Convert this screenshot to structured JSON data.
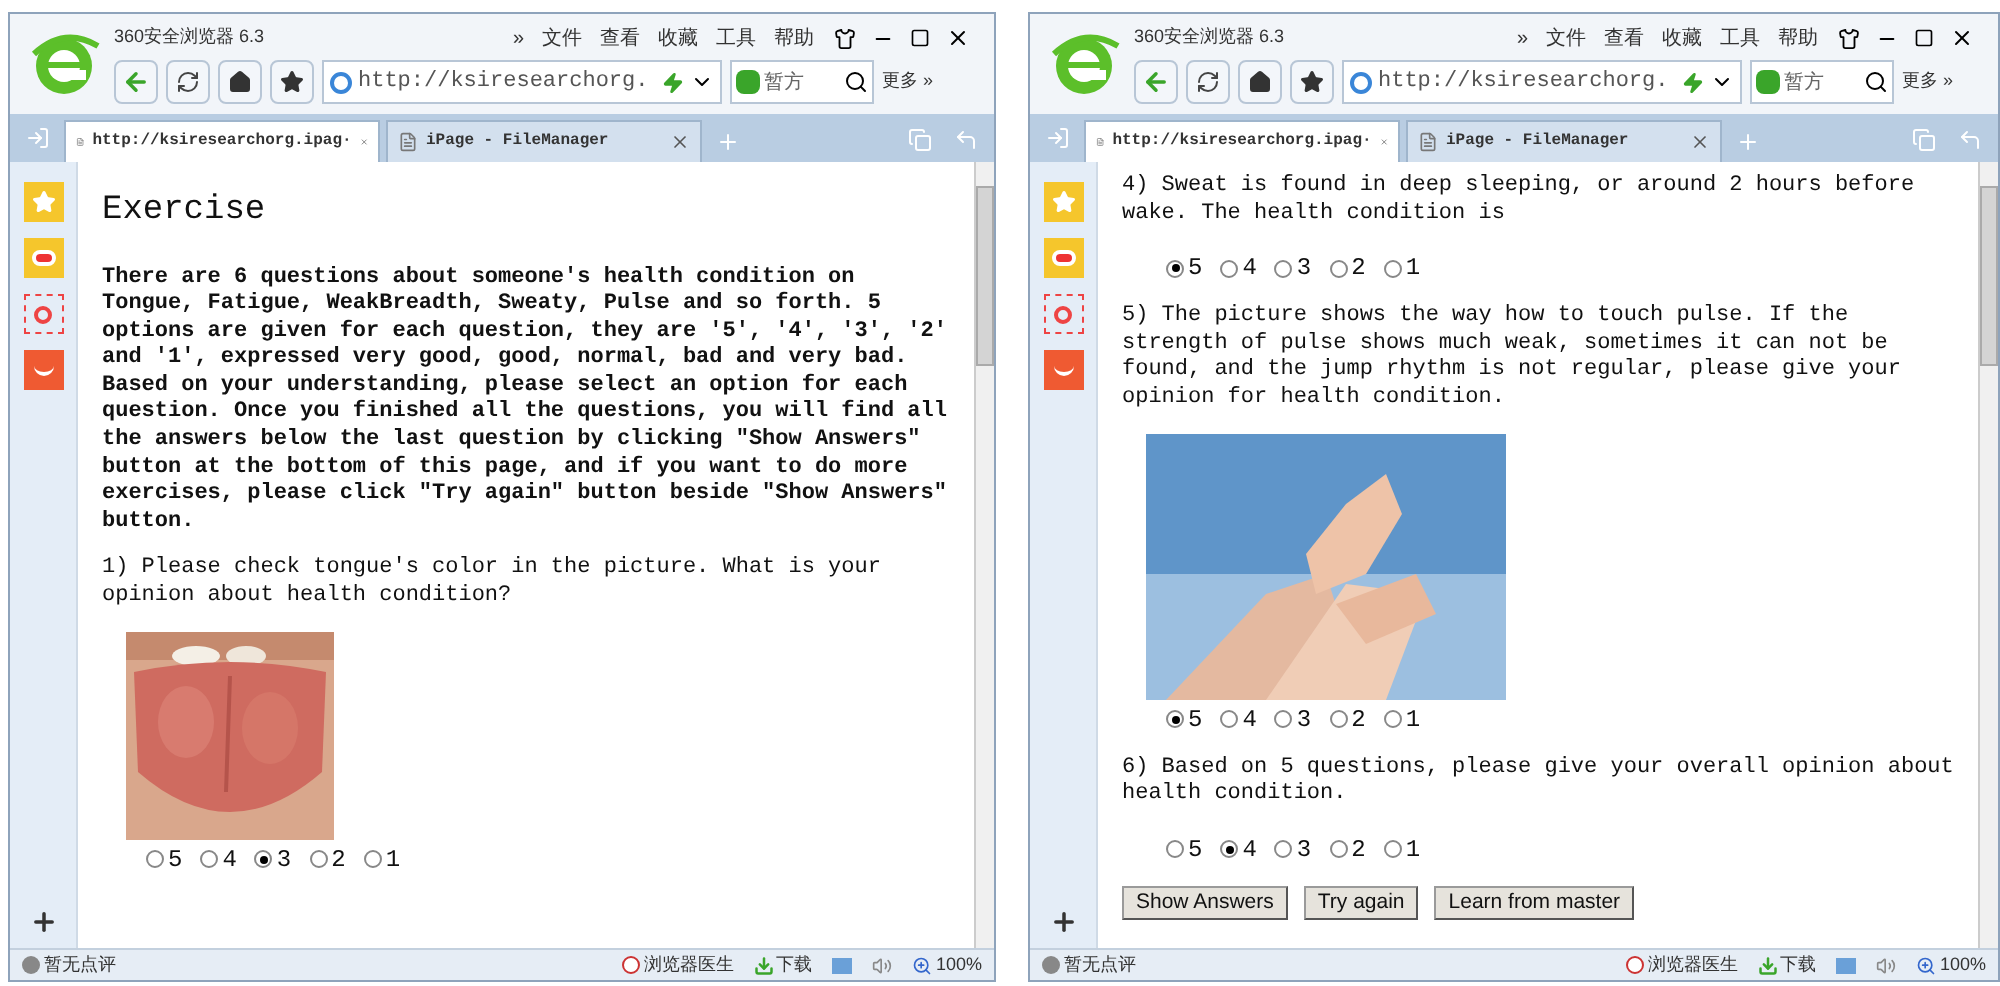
{
  "windows": [
    {
      "title": "360安全浏览器 6.3",
      "menu": [
        "»",
        "文件",
        "查看",
        "收藏",
        "工具",
        "帮助"
      ],
      "url": "http://ksiresearchorg.",
      "search_text": "暂方",
      "more": "更多 »",
      "tabs": [
        {
          "label": "http://ksiresearchorg.ipag·",
          "selected": true
        },
        {
          "label": "iPage - FileManager",
          "selected": false
        }
      ],
      "blocks": [
        {
          "kind": "heading",
          "text": "Exercise"
        },
        {
          "kind": "paragraph",
          "bold": true,
          "text": "There are 6 questions about someone's health condition on Tongue, Fatigue, WeakBreadth, Sweaty, Pulse and so forth. 5 options are given for each question, they are '5', '4', '3', '2' and '1', expressed very good, good, normal, bad and very bad. Based on your understanding, please select an option for each question. Once you finished all the questions, you will find all the answers below the last question by clicking \"Show Answers\" button at the bottom of this page, and if you want to do more exercises, please click \"Try again\" button beside \"Show Answers\" button."
        },
        {
          "kind": "paragraph",
          "bold": false,
          "text": "1) Please check tongue's color in the picture. What is your opinion about health condition?"
        },
        {
          "kind": "picture"
        },
        {
          "kind": "options",
          "items": [
            {
              "label": "5",
              "selected": false
            },
            {
              "label": "4",
              "selected": false
            },
            {
              "label": "3",
              "selected": true
            },
            {
              "label": "2",
              "selected": false
            },
            {
              "label": "1",
              "selected": false
            }
          ]
        }
      ],
      "status": {
        "review": "暂无点评",
        "doctor": "浏览器医生",
        "download": "下载",
        "zoom": "100%"
      }
    },
    {
      "title": "360安全浏览器 6.3",
      "menu": [
        "»",
        "文件",
        "查看",
        "收藏",
        "工具",
        "帮助"
      ],
      "url": "http://ksiresearchorg.",
      "search_text": "暂方",
      "more": "更多 »",
      "tabs": [
        {
          "label": "http://ksiresearchorg.ipag·",
          "selected": true
        },
        {
          "label": "iPage - FileManager",
          "selected": false
        }
      ],
      "blocks": [
        {
          "kind": "paragraph",
          "bold": false,
          "text": "4) Sweat is found in deep sleeping, or around 2 hours before wake. The health condition is"
        },
        {
          "kind": "options",
          "items": [
            {
              "label": "5",
              "selected": true
            },
            {
              "label": "4",
              "selected": false
            },
            {
              "label": "3",
              "selected": false
            },
            {
              "label": "2",
              "selected": false
            },
            {
              "label": "1",
              "selected": false
            }
          ]
        },
        {
          "kind": "paragraph",
          "bold": false,
          "text": "5) The picture shows the way how to touch pulse. If the strength of pulse shows much weak, sometimes it can not be found, and the jump rhythm is not regular, please give your opinion for health condition."
        },
        {
          "kind": "picture"
        },
        {
          "kind": "options",
          "items": [
            {
              "label": "5",
              "selected": true
            },
            {
              "label": "4",
              "selected": false
            },
            {
              "label": "3",
              "selected": false
            },
            {
              "label": "2",
              "selected": false
            },
            {
              "label": "1",
              "selected": false
            }
          ]
        },
        {
          "kind": "paragraph",
          "bold": false,
          "text": "6) Based on 5 questions, please give your overall opinion about health condition."
        },
        {
          "kind": "options",
          "items": [
            {
              "label": "5",
              "selected": false
            },
            {
              "label": "4",
              "selected": true
            },
            {
              "label": "3",
              "selected": false
            },
            {
              "label": "2",
              "selected": false
            },
            {
              "label": "1",
              "selected": false
            }
          ]
        },
        {
          "kind": "buttons",
          "items": [
            "Show Answers",
            "Try again",
            "Learn from master"
          ]
        }
      ],
      "status": {
        "review": "暂无点评",
        "doctor": "浏览器医生",
        "download": "下载",
        "zoom": "100%"
      }
    }
  ]
}
